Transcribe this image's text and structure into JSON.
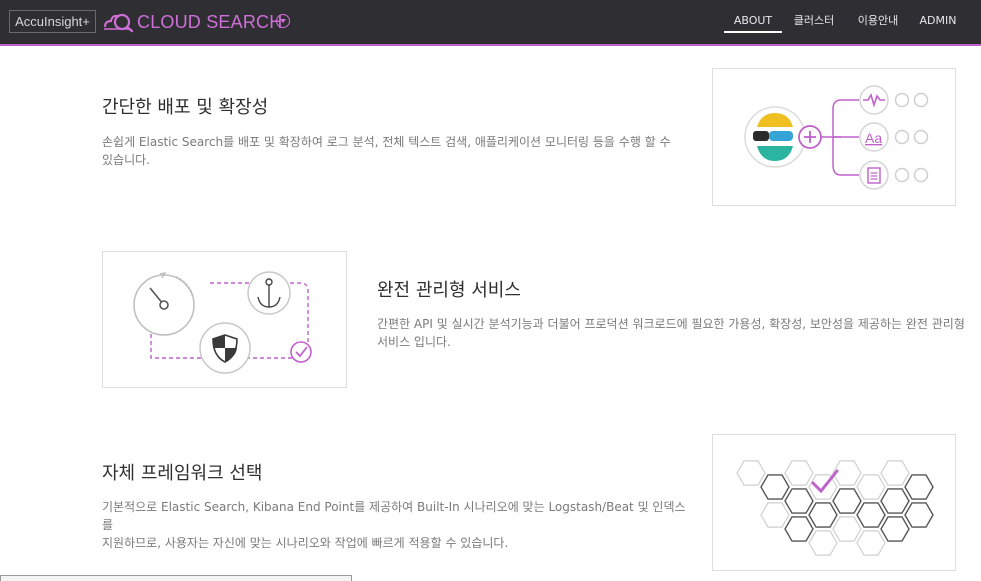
{
  "header": {
    "brand": "AccuInsight+",
    "product": "CLOUD SEARCH",
    "nav": [
      {
        "label": "ABOUT"
      },
      {
        "label": "클러스터"
      },
      {
        "label": "이용안내"
      },
      {
        "label": "ADMIN"
      }
    ],
    "accent_color": "#c061cb",
    "active_nav": "ABOUT"
  },
  "sections": [
    {
      "title": "간단한 배포 및 확장성",
      "description_line1": "손쉽게 Elastic Search를 배포 및 확장하여 로그 분석, 전체 텍스트 검색, 애플리케이션 모니터링 등을 수행 할 수",
      "description_line2": "있습니다.",
      "icons": [
        "elastic-logo-icon",
        "plus-icon",
        "activity-icon",
        "text-aa-icon",
        "document-icon"
      ],
      "text_aa": "Aa"
    },
    {
      "title": "완전 관리형 서비스",
      "description_line1": "간편한 API 및 실시간 분석기능과 더불어 프로덕션 워크로드에 필요한 가용성, 확장성, 보안성을 제공하는 완전 관리형",
      "description_line2": "서비스 입니다.",
      "icons": [
        "gauge-icon",
        "anchor-icon",
        "shield-icon",
        "check-circle-icon"
      ]
    },
    {
      "title": "자체 프레임워크 선택",
      "description_line1": "기본적으로 Elastic Search, Kibana End Point를 제공하여 Built-In 시나리오에 맞는 Logstash/Beat 및 인덱스를",
      "description_line2": "지원하므로, 사용자는 자신에 맞는 시나리오와 작업에 빠르게 적용할 수 있습니다.",
      "icons": [
        "hexagon-grid-icon",
        "check-icon"
      ]
    }
  ]
}
